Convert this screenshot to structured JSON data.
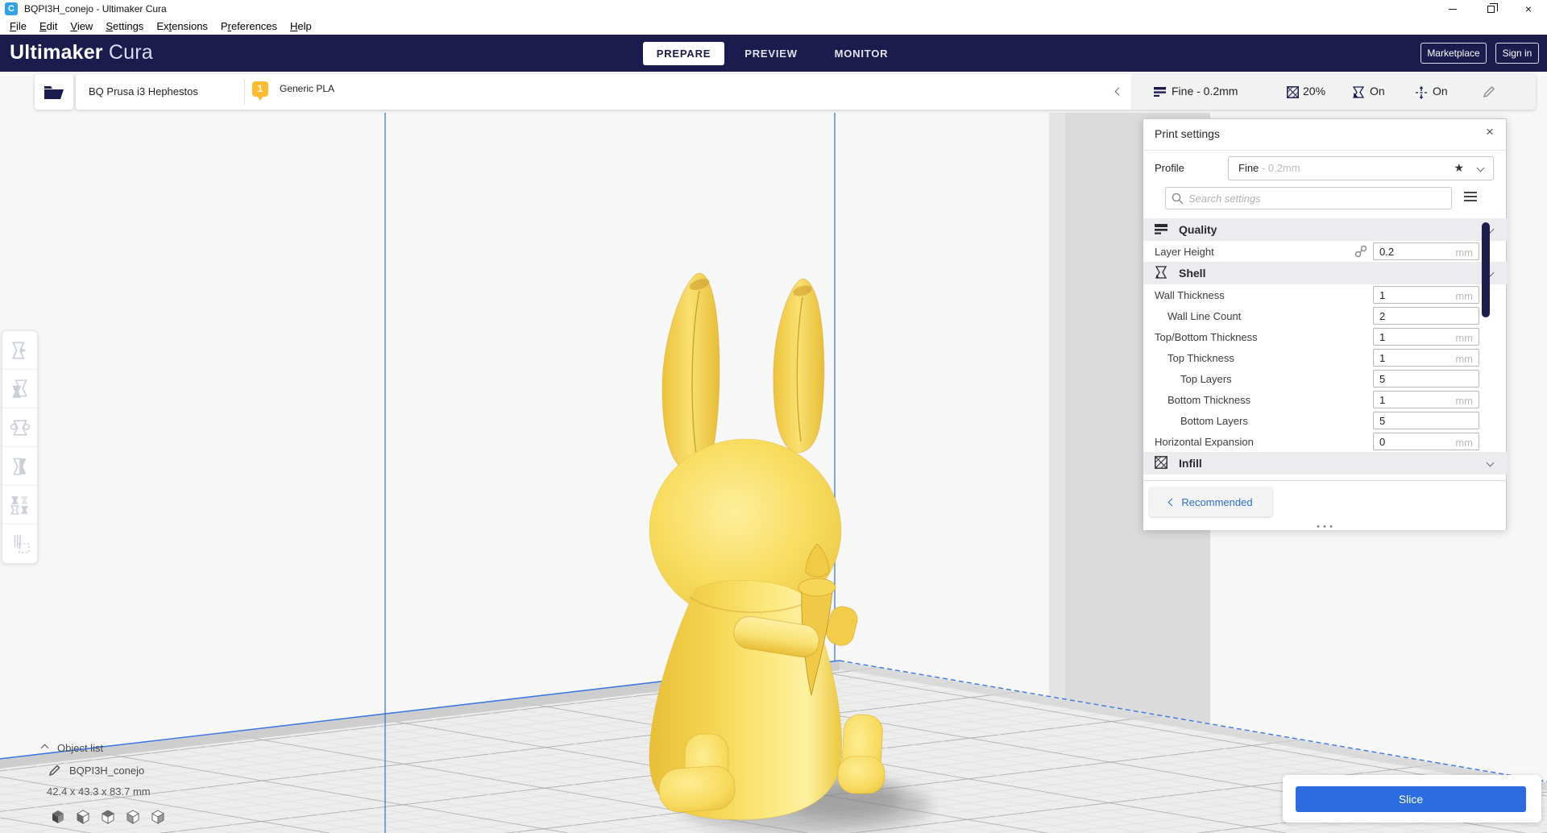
{
  "window": {
    "title": "BQPI3H_conejo - Ultimaker Cura",
    "app_icon_letter": "C"
  },
  "menu": {
    "items": [
      {
        "pre": "",
        "accel": "F",
        "post": "ile"
      },
      {
        "pre": "",
        "accel": "E",
        "post": "dit"
      },
      {
        "pre": "",
        "accel": "V",
        "post": "iew"
      },
      {
        "pre": "",
        "accel": "S",
        "post": "ettings"
      },
      {
        "pre": "Ex",
        "accel": "t",
        "post": "ensions"
      },
      {
        "pre": "P",
        "accel": "r",
        "post": "eferences"
      },
      {
        "pre": "",
        "accel": "H",
        "post": "elp"
      }
    ]
  },
  "header": {
    "logo_bold": "Ultimaker",
    "logo_light": "Cura",
    "tabs": [
      {
        "label": "PREPARE"
      },
      {
        "label": "PREVIEW"
      },
      {
        "label": "MONITOR"
      }
    ],
    "marketplace_label": "Marketplace",
    "signin_label": "Sign in"
  },
  "stage": {
    "printer_name": "BQ Prusa i3 Hephestos",
    "material_badge": "1",
    "material_name": "Generic PLA"
  },
  "summary": {
    "profile": "Fine - 0.2mm",
    "infill": "20%",
    "support": "On",
    "adhesion": "On"
  },
  "panel": {
    "title": "Print settings",
    "close": "×",
    "profile_label": "Profile",
    "profile_value": "Fine",
    "profile_suffix": " - 0.2mm",
    "search_placeholder": "Search settings",
    "settings": [
      {
        "type": "header",
        "label": "Quality"
      },
      {
        "type": "row",
        "label": "Layer Height",
        "value": "0.2",
        "unit": "mm"
      },
      {
        "type": "header",
        "label": "Shell"
      },
      {
        "type": "row",
        "label": "Wall Thickness",
        "value": "1",
        "unit": "mm"
      },
      {
        "type": "row",
        "label": "Wall Line Count",
        "value": "2",
        "unit": ""
      },
      {
        "type": "row",
        "label": "Top/Bottom Thickness",
        "value": "1",
        "unit": "mm"
      },
      {
        "type": "row",
        "label": "Top Thickness",
        "value": "1",
        "unit": "mm"
      },
      {
        "type": "row",
        "label": "Top Layers",
        "value": "5",
        "unit": ""
      },
      {
        "type": "row",
        "label": "Bottom Thickness",
        "value": "1",
        "unit": "mm"
      },
      {
        "type": "row",
        "label": "Bottom Layers",
        "value": "5",
        "unit": ""
      },
      {
        "type": "row",
        "label": "Horizontal Expansion",
        "value": "0",
        "unit": "mm"
      },
      {
        "type": "header",
        "label": "Infill"
      }
    ],
    "recommended_label": "Recommended"
  },
  "viewport": {
    "object_list_label": "Object list",
    "object_name": "BQPI3H_conejo",
    "dimensions": "42.4 x 43.3 x 83.7 mm",
    "slice_label": "Slice"
  },
  "colors": {
    "header_navy": "#1b1c4d",
    "accent_blue": "#2b6de0",
    "build_line_blue": "#3b77e3",
    "model_yellow": "#f6d654",
    "material_badge_yellow": "#fdbb2f"
  }
}
